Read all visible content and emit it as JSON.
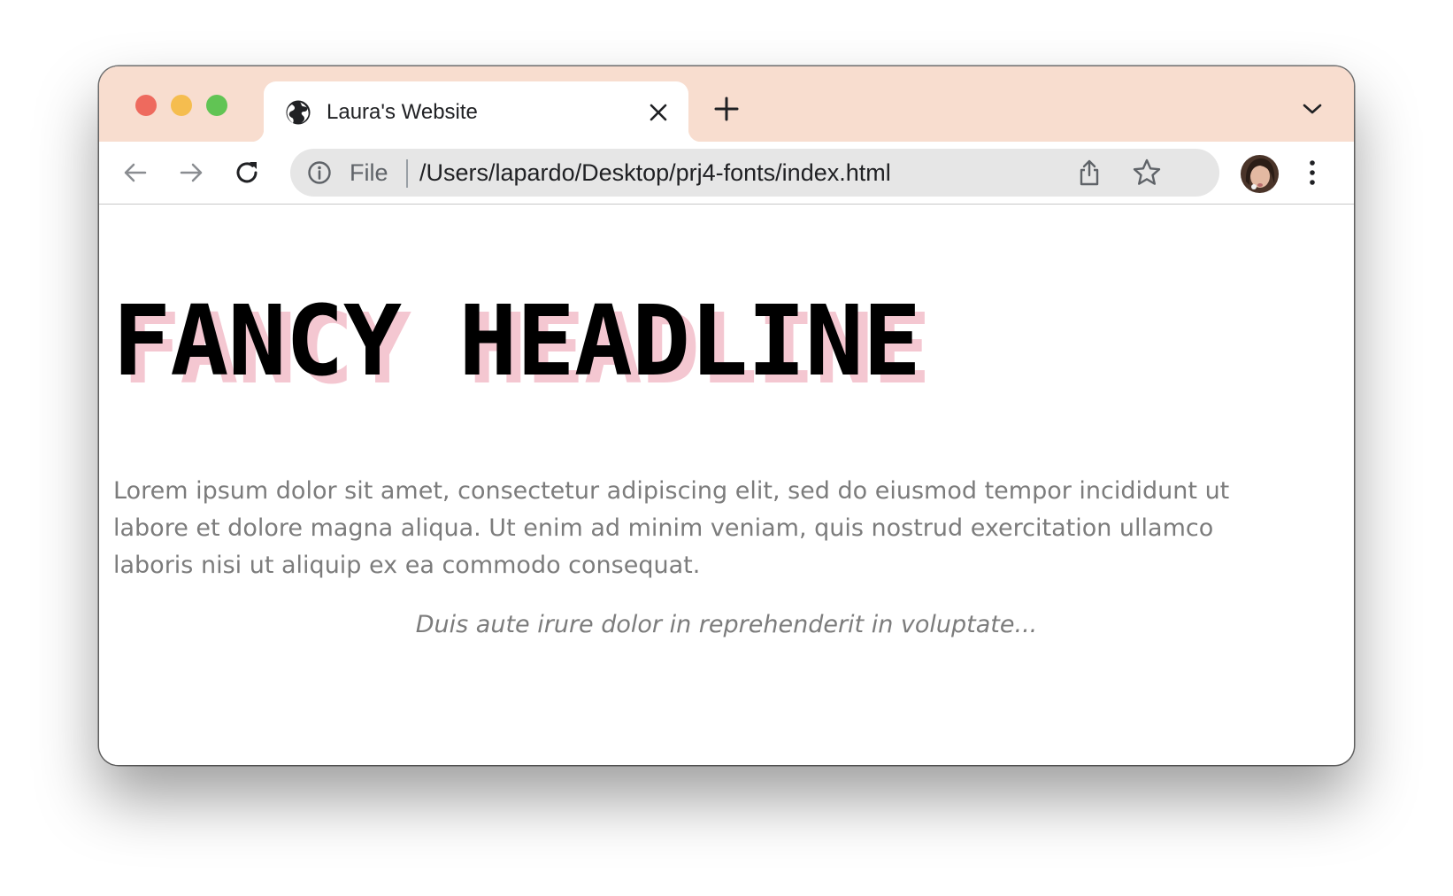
{
  "window": {
    "tab": {
      "title": "Laura's Website",
      "icon": "globe-icon"
    },
    "tabstrip_color": "#f8ddcf"
  },
  "toolbar": {
    "back_icon": "back-arrow-icon",
    "forward_icon": "forward-arrow-icon",
    "reload_icon": "reload-icon"
  },
  "omnibox": {
    "scheme_label": "File",
    "url": "/Users/lapardo/Desktop/prj4-fonts/index.html",
    "info_icon": "info-icon",
    "share_icon": "share-icon",
    "bookmark_icon": "star-icon"
  },
  "page": {
    "headline": "FANCY HEADLINE",
    "headline_color": "#000000",
    "headline_shadow_color": "#f4c7d1",
    "paragraph": "Lorem ipsum dolor sit amet, consectetur adipiscing elit, sed do eiusmod tempor incididunt ut labore et dolore magna aliqua. Ut enim ad minim veniam, quis nostrud exercitation ullamco laboris nisi ut aliquip ex ea commodo consequat.",
    "quote": "Duis aute irure dolor in reprehenderit in voluptate...",
    "text_color": "#7c7c7c"
  }
}
